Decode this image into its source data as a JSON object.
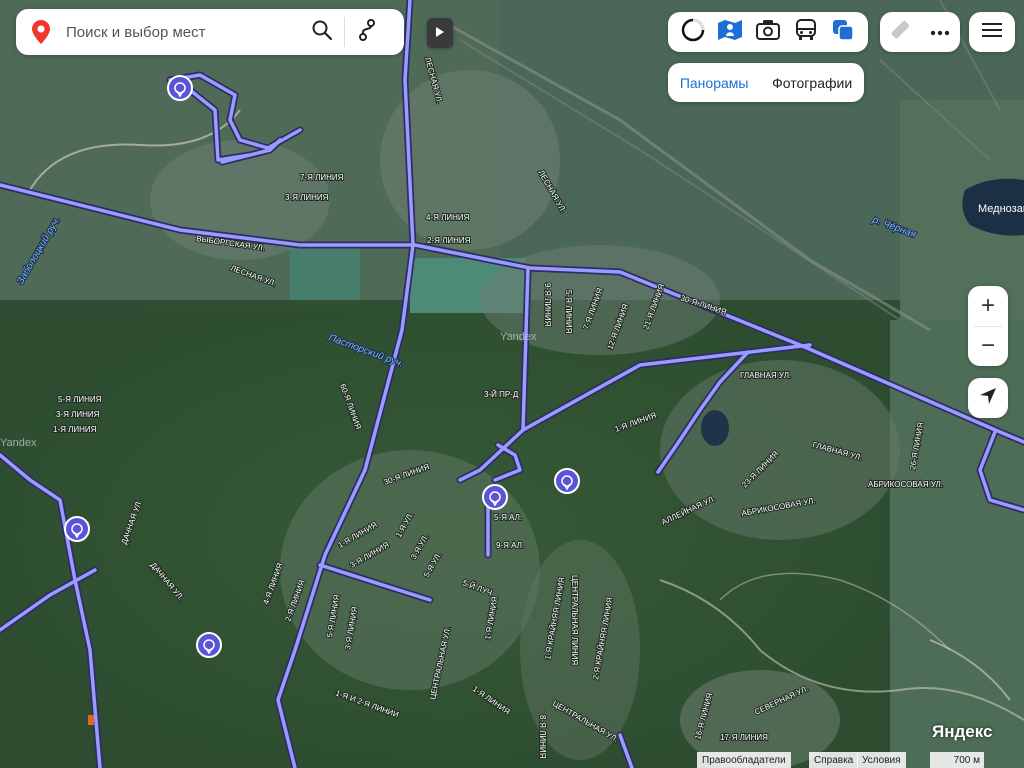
{
  "search": {
    "placeholder": "Поиск и выбор мест"
  },
  "layers": [
    {
      "name": "traffic-layer-icon"
    },
    {
      "name": "panoramas-layer-icon"
    },
    {
      "name": "photo-layer-icon"
    },
    {
      "name": "transport-layer-icon"
    },
    {
      "name": "map-type-icon"
    }
  ],
  "tabs": [
    {
      "label": "Панорамы",
      "active": true
    },
    {
      "label": "Фотографии",
      "active": false
    }
  ],
  "zoom": {
    "in": "+",
    "out": "−"
  },
  "footer": {
    "rights": "Правообладатели",
    "help": "Справка",
    "terms": "Условия",
    "scale": "700 м",
    "logo": "Яндекс"
  },
  "map_labels": {
    "lesnaya_north": "ЛЕСНАЯ УЛ.",
    "lesnaya_center": "ЛЕСНАЯ УЛ.",
    "lesnaya_west": "ЛЕСНАЯ УЛ.",
    "vyborgskaya": "ВЫБОРГСКАЯ УЛ.",
    "zabolotskii": "Заболоцкий руч.",
    "pastorskii": "Пасторский руч.",
    "chernaya": "р. Чёрная",
    "mednoz": "Меднозаводский разлив",
    "line_7": "7-Я ЛИНИЯ",
    "line_3a": "3-Я ЛИНИЯ",
    "line_4": "4-Я ЛИНИЯ",
    "line_2": "2-Я ЛИНИЯ",
    "line_5w": "5-Я ЛИНИЯ",
    "line_3w": "3-Я ЛИНИЯ",
    "line_1w": "1-Я ЛИНИЯ",
    "line_9": "9-Я ЛИНИЯ",
    "line_5": "5-Я ЛИНИЯ",
    "line_7b": "7-Я ЛИНИЯ",
    "line_12": "12-Я ЛИНИЯ",
    "line_21": "21-Я ЛИНИЯ",
    "line_30": "30-Я ЛИНИЯ",
    "line_60": "60-Я ЛИНИЯ",
    "line_30b": "30-Я ЛИНИЯ",
    "proezd_3": "3-Й ПР-Д",
    "line_1e": "1-Я ЛИНИЯ",
    "glavnaya1": "ГЛАВНАЯ УЛ.",
    "glavnaya2": "ГЛАВНАЯ УЛ.",
    "line_23": "23-Я ЛИНИЯ",
    "line_26": "26-Я ЛИНИЯ",
    "abrikos1": "АБРИКОСОВАЯ УЛ.",
    "abrikos2": "АБРИКОСОВАЯ УЛ.",
    "alleinaya": "АЛЛЕЙНАЯ УЛ.",
    "dachnaya1": "ДАЧНАЯ УЛ.",
    "dachnaya2": "ДАЧНАЯ УЛ.",
    "line_1s": "1-Я ЛИНИЯ",
    "line_3s": "3-Я ЛИНИЯ",
    "ul_1": "1-Я УЛ.",
    "ul_3": "3-Я УЛ.",
    "ul_5": "5-Я УЛ.",
    "al_5": "5-Я АЛ.",
    "al_9": "9-Я АЛ.",
    "luch_5": "5-Й ЛУЧ",
    "line_4s": "4-Я ЛИНИЯ",
    "line_2s": "2-Я ЛИНИЯ",
    "line_5s": "5-Я ЛИНИЯ",
    "line_3ss": "3-Я ЛИНИЯ",
    "line_1ss": "1-Я ЛИНИЯ",
    "central1": "ЦЕНТРАЛЬНАЯ УЛ.",
    "central_line": "ЦЕНТРАЛЬНАЯ ЛИНИЯ",
    "krainyaya1": "1-Я КРАЙНЯЯ ЛИНИЯ",
    "krainyaya2": "2-Я КРАЙНЯЯ ЛИНИЯ",
    "line_8": "8-Я ЛИНИЯ",
    "central2": "ЦЕНТРАЛЬНАЯ УЛ.",
    "line_1f": "1-Я ЛИНИЯ",
    "line_12_2": "1-Я И 2-Я ЛИНИИ",
    "severnaya": "СЕВЕРНАЯ УЛ.",
    "line_16": "16-Я ЛИНИЯ",
    "line_17": "17-Я ЛИНИЯ",
    "yandex1": "Yandex",
    "yandex2": "Yandex"
  },
  "colors": {
    "route": "#9b9bff",
    "route_casing": "#2e2e66",
    "panorama_marker": "#5a55d6"
  }
}
